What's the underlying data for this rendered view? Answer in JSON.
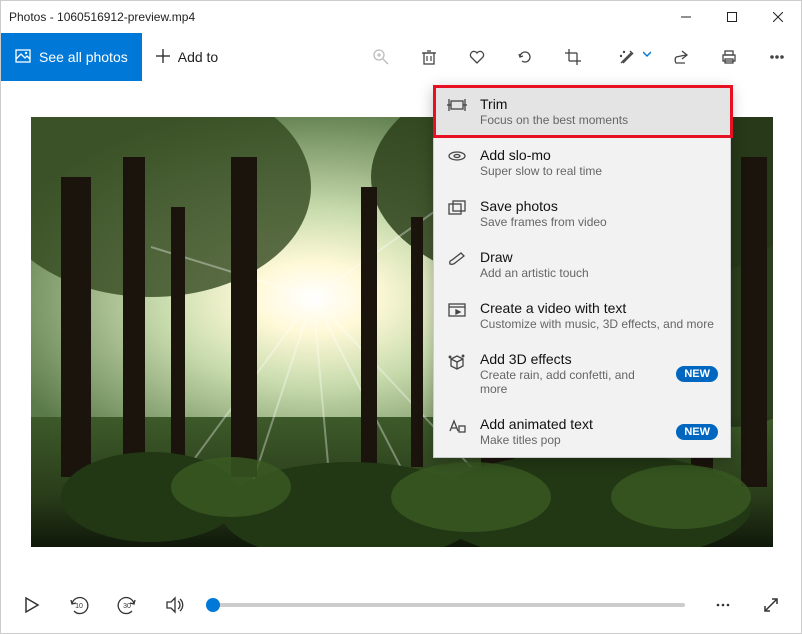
{
  "title": "Photos - 1060516912-preview.mp4",
  "toolbar": {
    "see_all": "See all photos",
    "add_to": "Add to"
  },
  "dropdown": {
    "items": [
      {
        "title": "Trim",
        "sub": "Focus on the best moments",
        "badge": ""
      },
      {
        "title": "Add slo-mo",
        "sub": "Super slow to real time",
        "badge": ""
      },
      {
        "title": "Save photos",
        "sub": "Save frames from video",
        "badge": ""
      },
      {
        "title": "Draw",
        "sub": "Add an artistic touch",
        "badge": ""
      },
      {
        "title": "Create a video with text",
        "sub": "Customize with music, 3D effects, and more",
        "badge": ""
      },
      {
        "title": "Add 3D effects",
        "sub": "Create rain, add confetti, and more",
        "badge": "NEW"
      },
      {
        "title": "Add animated text",
        "sub": "Make titles pop",
        "badge": "NEW"
      }
    ]
  },
  "playback": {
    "back": "10",
    "fwd": "30"
  }
}
